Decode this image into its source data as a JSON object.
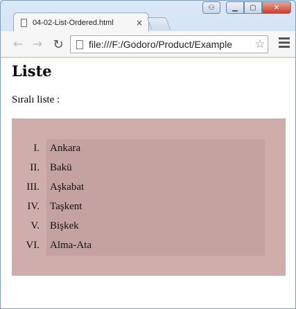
{
  "browser": {
    "tab_title": "04-02-List-Ordered.html",
    "tab_close": "×",
    "url": "file:///F:/Godoro/Product/Example",
    "back_icon": "back-arrow-icon",
    "forward_icon": "forward-arrow-icon",
    "reload_icon": "reload-icon",
    "star_icon": "star-icon",
    "menu_icon": "hamburger-menu-icon"
  },
  "page": {
    "heading": "Liste",
    "intro": "Sıralı liste :",
    "list": {
      "numerals": [
        "I.",
        "II.",
        "III.",
        "IV.",
        "V.",
        "VI."
      ],
      "items": [
        "Ankara",
        "Bakü",
        "Aşkabat",
        "Taşkent",
        "Bişkek",
        "Alma-Ata"
      ]
    }
  },
  "colors": {
    "list_outer_bg": "#cfadab",
    "list_inner_bg": "#c4a2a0"
  }
}
